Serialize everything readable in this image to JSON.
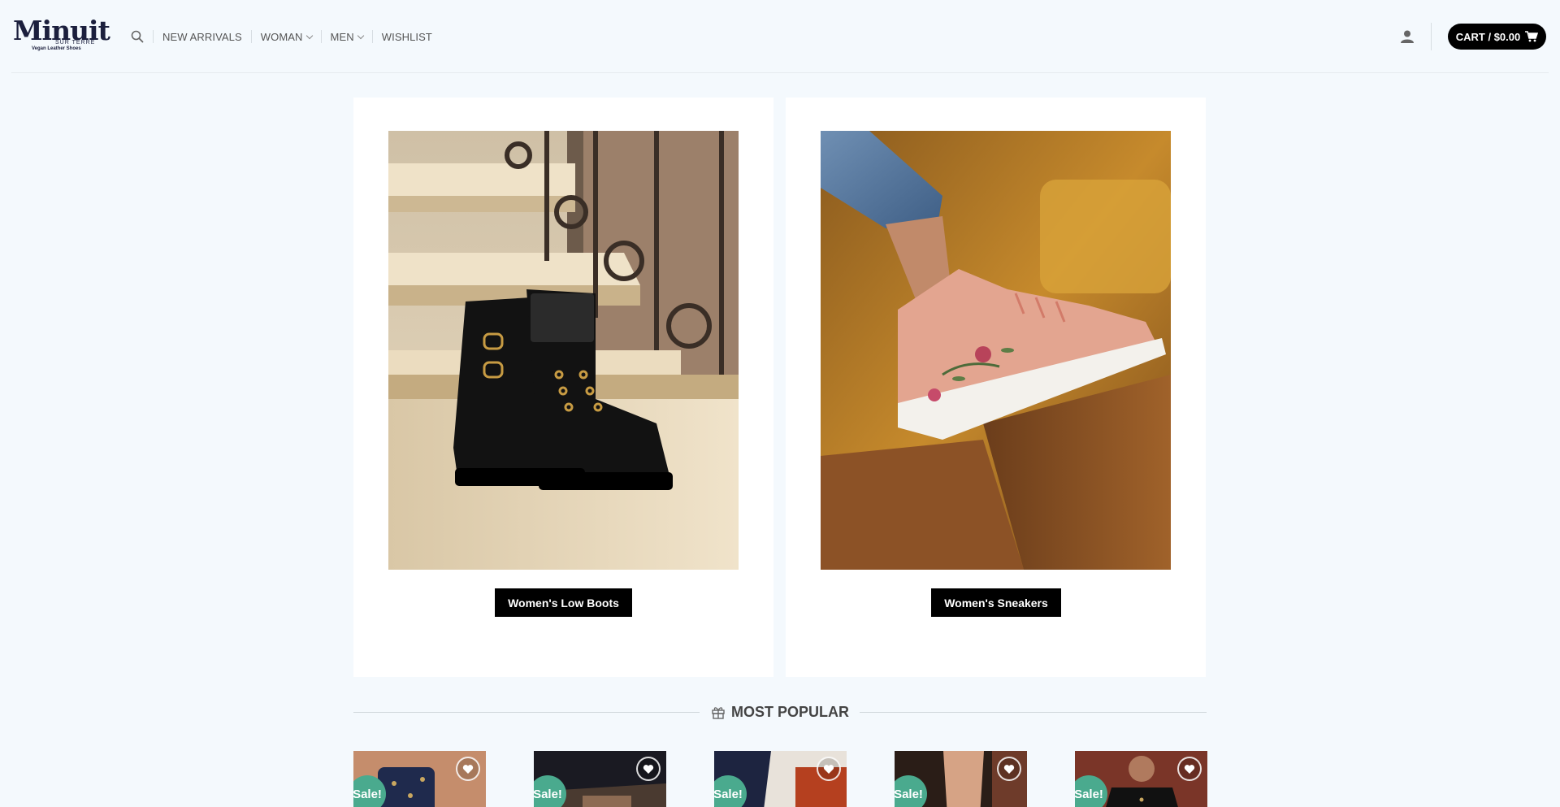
{
  "header": {
    "logo": {
      "main": "Minuit",
      "sub": "SUR TERRE",
      "tagline": "Vegan Leather Shoes"
    },
    "nav": [
      {
        "label": "NEW ARRIVALS",
        "has_dropdown": false
      },
      {
        "label": "WOMAN",
        "has_dropdown": true
      },
      {
        "label": "MEN",
        "has_dropdown": true
      },
      {
        "label": "WISHLIST",
        "has_dropdown": false
      }
    ],
    "cart_label": "CART / $0.00",
    "icons": [
      "search-icon",
      "user-icon",
      "cart-icon"
    ]
  },
  "categories": [
    {
      "button": "Women's Low Boots",
      "image": "black-leather-lace-up-boots-on-stone-stairs"
    },
    {
      "button": "Women's Sneakers",
      "image": "pink-floral-embroidered-sneaker"
    }
  ],
  "most_popular": {
    "title": "MOST POPULAR",
    "icon": "gift-icon",
    "products": [
      {
        "badge": "Sale!",
        "icon": "heart-icon"
      },
      {
        "badge": "Sale!",
        "icon": "heart-icon"
      },
      {
        "badge": "Sale!",
        "icon": "heart-icon"
      },
      {
        "badge": "Sale!",
        "icon": "heart-icon"
      },
      {
        "badge": "Sale!",
        "icon": "heart-icon"
      }
    ]
  },
  "colors": {
    "background": "#f4f9fd",
    "accent_sale": "#4aaa8e",
    "button": "#000000",
    "text": "#555555"
  }
}
